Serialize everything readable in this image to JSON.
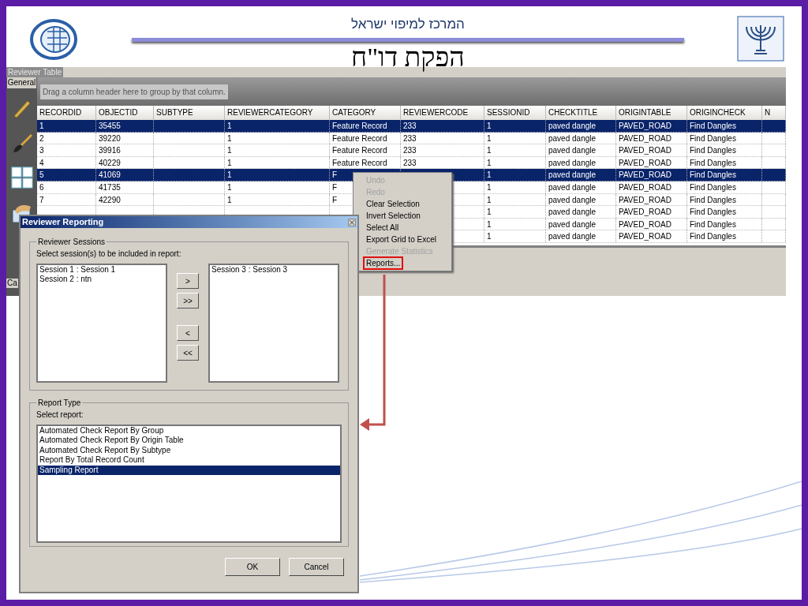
{
  "slide": {
    "subtitle": "המרכז למיפוי ישראל",
    "title": "הפקת דו\"ח"
  },
  "app": {
    "title": "Reviewer Table",
    "tab": "General",
    "group_hint": "Drag a column header here to group by that column.",
    "side_label": "Ca",
    "table": {
      "columns": [
        "RECORDID",
        "OBJECTID",
        "SUBTYPE",
        "REVIEWERCATEGORY",
        "CATEGORY",
        "REVIEWERCODE",
        "SESSIONID",
        "CHECKTITLE",
        "ORIGINTABLE",
        "ORIGINCHECK",
        "N"
      ],
      "rows": [
        {
          "selected": true,
          "cells": [
            "1",
            "35455",
            null,
            "1",
            "Feature Record",
            "233",
            "1",
            "paved dangle",
            "PAVED_ROAD",
            "Find Dangles",
            null
          ]
        },
        {
          "selected": false,
          "cells": [
            "2",
            "39220",
            null,
            "1",
            "Feature Record",
            "233",
            "1",
            "paved dangle",
            "PAVED_ROAD",
            "Find Dangles",
            null
          ]
        },
        {
          "selected": false,
          "cells": [
            "3",
            "39916",
            null,
            "1",
            "Feature Record",
            "233",
            "1",
            "paved dangle",
            "PAVED_ROAD",
            "Find Dangles",
            null
          ]
        },
        {
          "selected": false,
          "cells": [
            "4",
            "40229",
            null,
            "1",
            "Feature Record",
            "233",
            "1",
            "paved dangle",
            "PAVED_ROAD",
            "Find Dangles",
            null
          ]
        },
        {
          "selected": true,
          "cells": [
            "5",
            "41069",
            null,
            "1",
            "F",
            null,
            "1",
            "paved dangle",
            "PAVED_ROAD",
            "Find Dangles",
            null
          ]
        },
        {
          "selected": false,
          "cells": [
            "6",
            "41735",
            null,
            "1",
            "F",
            null,
            "1",
            "paved dangle",
            "PAVED_ROAD",
            "Find Dangles",
            null
          ]
        },
        {
          "selected": false,
          "cells": [
            "7",
            "42290",
            null,
            "1",
            "F",
            null,
            "1",
            "paved dangle",
            "PAVED_ROAD",
            "Find Dangles",
            null
          ]
        },
        {
          "selected": false,
          "cells": [
            null,
            null,
            null,
            null,
            null,
            null,
            "1",
            "paved dangle",
            "PAVED_ROAD",
            "Find Dangles",
            null
          ]
        },
        {
          "selected": false,
          "cells": [
            null,
            null,
            null,
            null,
            null,
            null,
            "1",
            "paved dangle",
            "PAVED_ROAD",
            "Find Dangles",
            null
          ]
        },
        {
          "selected": false,
          "cells": [
            null,
            null,
            null,
            null,
            null,
            null,
            "1",
            "paved dangle",
            "PAVED_ROAD",
            "Find Dangles",
            null
          ]
        }
      ]
    }
  },
  "context_menu": {
    "items": [
      {
        "label": "Undo",
        "disabled": true,
        "outlined": false
      },
      {
        "label": "Redo",
        "disabled": true,
        "outlined": false
      },
      {
        "label": "Clear Selection",
        "disabled": false,
        "outlined": false
      },
      {
        "label": "Invert Selection",
        "disabled": false,
        "outlined": false
      },
      {
        "label": "Select All",
        "disabled": false,
        "outlined": false
      },
      {
        "label": "Export Grid to Excel",
        "disabled": false,
        "outlined": false
      },
      {
        "label": "Generate Statistics",
        "disabled": true,
        "outlined": false
      },
      {
        "label": "Reports...",
        "disabled": false,
        "outlined": true
      }
    ]
  },
  "dialog": {
    "title": "Reviewer Reporting",
    "sessions": {
      "label": "Reviewer Sessions",
      "instruction": "Select session(s) to be included in report:",
      "available": [
        "Session 1 : Session 1",
        "Session 2 : ntn"
      ],
      "chosen": [
        "Session 3 : Session 3"
      ],
      "move_buttons": [
        ">",
        ">>",
        "<",
        "<<"
      ]
    },
    "report_type": {
      "label": "Report Type",
      "instruction": "Select report:",
      "reports": [
        {
          "label": "Automated Check Report By Group",
          "selected": false
        },
        {
          "label": "Automated Check Report By Origin Table",
          "selected": false
        },
        {
          "label": "Automated Check Report By Subtype",
          "selected": false
        },
        {
          "label": "Report By Total Record Count",
          "selected": false
        },
        {
          "label": "Sampling Report",
          "selected": true
        }
      ]
    },
    "buttons": [
      "OK",
      "Cancel"
    ]
  }
}
